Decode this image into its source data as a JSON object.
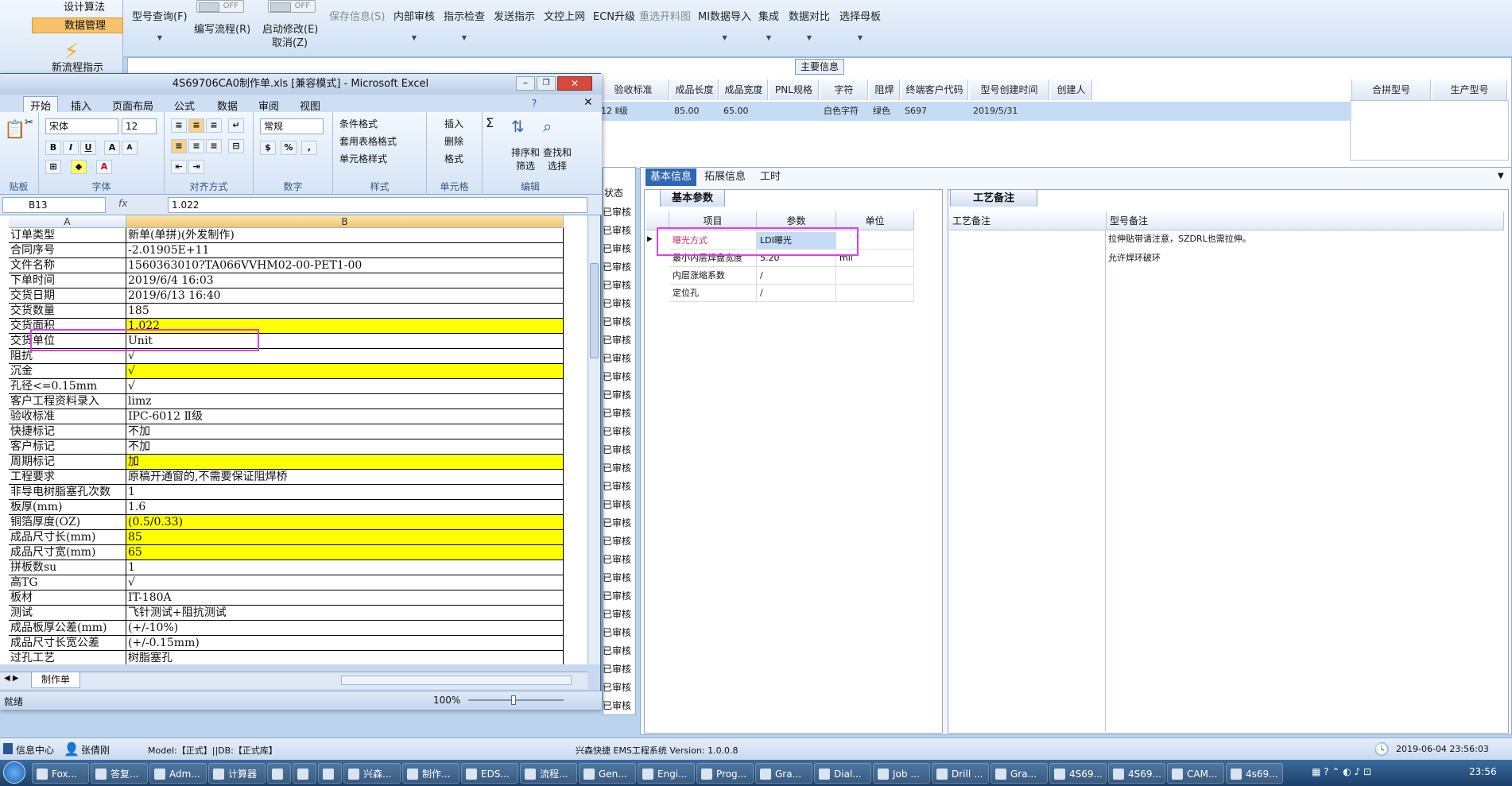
{
  "app": {
    "left_nav": [
      "设计算法",
      "数据管理",
      "新流程指示"
    ],
    "ribbon": [
      {
        "label": "型号查询(F)",
        "disabled": false
      },
      {
        "label": "编写流程(R)",
        "disabled": false
      },
      {
        "label": "启动修改(E)",
        "disabled": false
      },
      {
        "label": "取消(Z)",
        "disabled": false
      },
      {
        "label": "保存信息(S)",
        "disabled": true
      },
      {
        "label": "内部审核",
        "disabled": false
      },
      {
        "label": "指示检查",
        "disabled": false
      },
      {
        "label": "发送指示",
        "disabled": false
      },
      {
        "label": "文控上网",
        "disabled": false
      },
      {
        "label": "ECN升级",
        "disabled": false
      },
      {
        "label": "重选开料图",
        "disabled": true
      },
      {
        "label": "MI数据导入",
        "disabled": false
      },
      {
        "label": "集成",
        "disabled": false
      },
      {
        "label": "数据对比",
        "disabled": false
      },
      {
        "label": "选择母板",
        "disabled": false
      }
    ],
    "toggle_off": "OFF",
    "main_info": {
      "title": "主要信息",
      "headers": [
        "验收标准",
        "成品长度",
        "成品宽度",
        "PNL规格",
        "字符",
        "阻焊",
        "终端客户代码",
        "型号创建时间",
        "创建人"
      ],
      "row": [
        "12 Ⅱ级",
        "85.00",
        "65.00",
        "",
        "白色字符",
        "绿色",
        "S697",
        "2019/5/31",
        ""
      ],
      "side_headers": [
        "合拼型号",
        "生产型号"
      ]
    },
    "tabs": [
      "基本信息",
      "拓展信息",
      "工时"
    ],
    "basic_params": {
      "title": "基本参数",
      "headers": [
        "项目",
        "参数",
        "单位"
      ],
      "rows": [
        [
          "曝光方式",
          "LDI曝光",
          ""
        ],
        [
          "最小内层焊盘宽度",
          "5.20",
          "mil"
        ],
        [
          "内层涨缩系数",
          "/",
          ""
        ],
        [
          "定位孔",
          "/",
          ""
        ]
      ]
    },
    "process_notes": {
      "title": "工艺备注",
      "headers": [
        "工艺备注",
        "型号备注"
      ],
      "lines": [
        "拉伸贴带请注意，SZDRL也需拉伸。",
        "允许焊环破环"
      ]
    },
    "mid_status": "已审核",
    "mid_header": "状态",
    "status_bar": {
      "left": "信息中心",
      "user": "张倩刚",
      "model": "Model:【正式】||DB:【正式库】",
      "center": "兴森快捷 EMS工程系统  Version: 1.0.0.8",
      "datetime": "2019-06-04 23:56:03"
    }
  },
  "excel": {
    "title": "4S69706CA0制作单.xls [兼容模式] - Microsoft Excel",
    "tabs": [
      "开始",
      "插入",
      "页面布局",
      "公式",
      "数据",
      "审阅",
      "视图"
    ],
    "font_name": "宋体",
    "font_size": "12",
    "number_format": "常规",
    "groups": [
      "贴板",
      "字体",
      "对齐方式",
      "数字",
      "样式",
      "单元格",
      "编辑"
    ],
    "style_items": [
      "条件格式",
      "套用表格格式",
      "单元格样式"
    ],
    "cell_items": [
      "插入",
      "删除",
      "格式"
    ],
    "edit_items": [
      "排序和筛选",
      "查找和选择"
    ],
    "name_box": "B13",
    "formula": "1.022",
    "col_a": "A",
    "col_b": "B",
    "rows": [
      [
        "订单类型",
        "新单(单拼)(外发制作)",
        false
      ],
      [
        "合同序号",
        "-2.01905E+11",
        false
      ],
      [
        "文件名称",
        "1560363010?TA066VVHM02-00-PET1-00",
        false
      ],
      [
        "下单时间",
        "2019/6/4 16:03",
        false
      ],
      [
        "交货日期",
        "2019/6/13 16:40",
        false
      ],
      [
        "交货数量",
        "185",
        false
      ],
      [
        "交货面积",
        "1.022",
        true
      ],
      [
        "交货单位",
        "Unit",
        false
      ],
      [
        "阻抗",
        "√",
        false
      ],
      [
        "沉金",
        "√",
        true
      ],
      [
        "孔径<=0.15mm",
        "√",
        false
      ],
      [
        "客户工程资料录入",
        "limz",
        false
      ],
      [
        "验收标准",
        "IPC-6012 Ⅱ级",
        false
      ],
      [
        "快捷标记",
        "不加",
        false
      ],
      [
        "客户标记",
        "不加",
        false
      ],
      [
        "周期标记",
        "加",
        true
      ],
      [
        "工程要求",
        "原稿开通窗的,不需要保证阻焊桥",
        false
      ],
      [
        "非导电树脂塞孔次数",
        "1",
        false
      ],
      [
        "板厚(mm)",
        "1.6",
        false
      ],
      [
        "铜箔厚度(OZ)",
        "(0.5/0.33)",
        true
      ],
      [
        "成品尺寸长(mm)",
        "85",
        true
      ],
      [
        "成品尺寸宽(mm)",
        "65",
        true
      ],
      [
        "拼板数su",
        "1",
        false
      ],
      [
        "高TG",
        "√",
        false
      ],
      [
        "板材",
        "IT-180A",
        false
      ],
      [
        "测试",
        "飞针测试+阻抗测试",
        false
      ],
      [
        "成品板厚公差(mm)",
        "(+/-10%)",
        false
      ],
      [
        "成品尺寸长宽公差",
        "(+/-0.15mm)",
        false
      ],
      [
        "过孔工艺",
        "树脂塞孔",
        false
      ]
    ],
    "sheet_tab": "制作单",
    "zoom": "100%",
    "status_left": "就绪"
  },
  "taskbar": {
    "items": [
      "Fox...",
      "答复...",
      "Adm...",
      "计算器",
      "",
      "",
      "",
      "兴森...",
      "制作...",
      "EDS...",
      "流程...",
      "Gen...",
      "Engi...",
      "Prog...",
      "Gra...",
      "Dial...",
      "Job ...",
      "Drill ...",
      "Gra...",
      "4S69...",
      "4S69...",
      "CAM...",
      "4s69..."
    ],
    "clock": "23:56"
  }
}
